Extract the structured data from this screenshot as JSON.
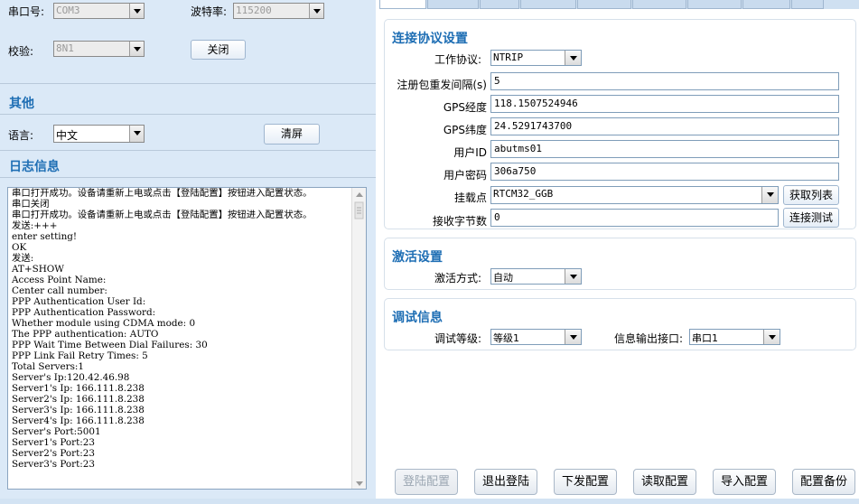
{
  "serial": {
    "port_label": "串口号:",
    "port_value": "COM3",
    "baud_label": "波特率:",
    "baud_value": "115200",
    "check_label": "校验:",
    "check_value": "8N1",
    "close_label": "关闭"
  },
  "other": {
    "title": "其他",
    "language_label": "语言:",
    "language_value": "中文",
    "clear_label": "清屏"
  },
  "log": {
    "title": "日志信息",
    "lines": [
      "串口打开成功。设备请重新上电或点击【登陆配置】按钮进入配置状态。",
      "串口关闭",
      "串口打开成功。设备请重新上电或点击【登陆配置】按钮进入配置状态。",
      "发送:+++",
      "enter setting!",
      "OK",
      "发送:",
      "AT+SHOW",
      "Access Point Name:",
      "Center call number:",
      "PPP Authentication User Id:",
      "PPP Authentication Password:",
      "Whether module using CDMA mode: 0",
      "The PPP authentication: AUTO",
      "PPP Wait Time Between Dial Failures: 30",
      "PPP Link Fail Retry Times: 5",
      "Total Servers:1",
      "Server's Ip:120.42.46.98",
      "Server1's Ip: 166.111.8.238",
      "Server2's Ip: 166.111.8.238",
      "Server3's Ip: 166.111.8.238",
      "Server4's Ip: 166.111.8.238",
      "Server's Port:5001",
      "Server1's Port:23",
      "Server2's Port:23",
      "Server3's Port:23"
    ]
  },
  "connection": {
    "title": "连接协议设置",
    "protocol_label": "工作协议:",
    "protocol_value": "NTRIP",
    "interval_label": "注册包重发间隔(s)",
    "interval_value": "5",
    "lon_label": "GPS经度",
    "lon_value": "118.1507524946",
    "lat_label": "GPS纬度",
    "lat_value": "24.5291743700",
    "userid_label": "用户ID",
    "userid_value": "abutms01",
    "password_label": "用户密码",
    "password_value": "306a750",
    "mount_label": "挂载点",
    "mount_value": "RTCM32_GGB",
    "get_list_label": "获取列表",
    "bytes_label": "接收字节数",
    "bytes_value": "0",
    "test_label": "连接测试"
  },
  "activation": {
    "title": "激活设置",
    "mode_label": "激活方式:",
    "mode_value": "自动"
  },
  "debug": {
    "title": "调试信息",
    "level_label": "调试等级:",
    "level_value": "等级1",
    "port_label": "信息输出接口:",
    "port_value": "串口1"
  },
  "actions": {
    "login": "登陆配置",
    "logout": "退出登陆",
    "download": "下发配置",
    "read": "读取配置",
    "import": "导入配置",
    "backup": "配置备份"
  }
}
